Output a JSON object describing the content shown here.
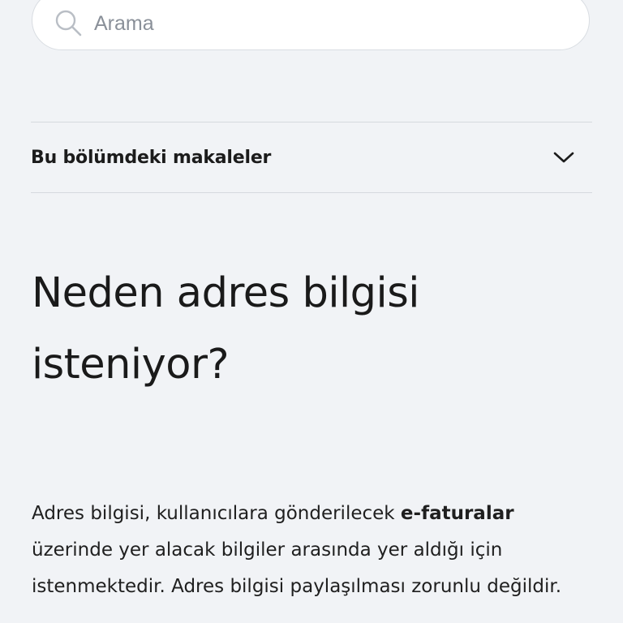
{
  "search": {
    "placeholder": "Arama",
    "value": ""
  },
  "section": {
    "articles_label": "Bu bölümdeki makaleler"
  },
  "article": {
    "title": "Neden adres bilgisi isteniyor?",
    "paragraph": {
      "part1": "Adres bilgisi, kullanıcılara gönderilecek ",
      "bold": "e-faturalar",
      "part2": " üzerinde yer alacak bilgiler arasında yer aldığı için istenmektedir. Adres bilgisi paylaşılması zorunlu değildir."
    }
  },
  "icons": {
    "search": "search-icon",
    "chevron": "chevron-down-icon"
  },
  "colors": {
    "background": "#f1f3f6",
    "text": "#1a1a1a",
    "placeholder": "#8a9099",
    "divider": "#d6d9de"
  }
}
